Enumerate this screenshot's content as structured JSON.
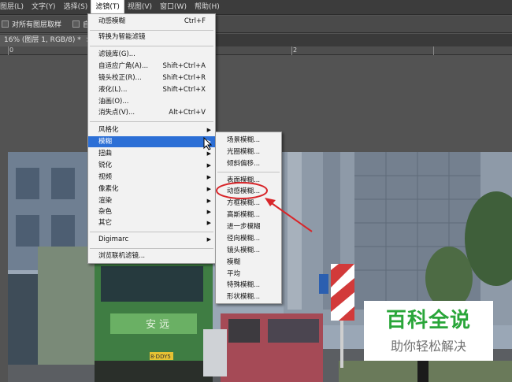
{
  "menubar": {
    "items": [
      {
        "label": "图层(L)"
      },
      {
        "label": "文字(Y)"
      },
      {
        "label": "选择(S)"
      },
      {
        "label": "滤镜(T)"
      },
      {
        "label": "视图(V)"
      },
      {
        "label": "窗口(W)"
      },
      {
        "label": "帮助(H)"
      }
    ]
  },
  "options_bar": {
    "sample_all_layers": "对所有图层取样",
    "auto_label": "自动"
  },
  "document_tab": {
    "label": "16% (图层 1, RGB/8) *",
    "close": "×"
  },
  "ruler": {
    "labels": [
      "0",
      "2"
    ]
  },
  "filter_menu": {
    "last_filter": {
      "label": "动感模糊",
      "shortcut": "Ctrl+F"
    },
    "convert_smart": "转换为智能滤镜",
    "gallery": "滤镜库(G)...",
    "adaptive_wide": {
      "label": "自适应广角(A)...",
      "shortcut": "Shift+Ctrl+A"
    },
    "lens_correction": {
      "label": "镜头校正(R)...",
      "shortcut": "Shift+Ctrl+R"
    },
    "liquify": {
      "label": "液化(L)...",
      "shortcut": "Shift+Ctrl+X"
    },
    "oil_paint": "油画(O)...",
    "vanishing_point": {
      "label": "消失点(V)...",
      "shortcut": "Alt+Ctrl+V"
    },
    "stylize": "风格化",
    "blur": "模糊",
    "distort": "扭曲",
    "sharpen": "锐化",
    "video": "视频",
    "pixelate": "像素化",
    "render": "渲染",
    "noise": "杂色",
    "other": "其它",
    "digimarc": "Digimarc",
    "browse_online": "浏览联机滤镜..."
  },
  "blur_submenu": {
    "items": [
      "场景模糊...",
      "光圈模糊...",
      "倾斜偏移...",
      "表面模糊...",
      "动感模糊...",
      "方框模糊...",
      "高斯模糊...",
      "进一步模糊",
      "径向模糊...",
      "镜头模糊...",
      "模糊",
      "平均",
      "特殊模糊...",
      "形状模糊..."
    ]
  },
  "photo": {
    "truck_sign": "安 远",
    "plate": "8·DDY5"
  },
  "watermark": {
    "title": "百科全说",
    "subtitle": "助你轻松解决",
    "color": "#2aa63a"
  },
  "colors": {
    "menu_highlight": "#2c6fd6",
    "annotation_red": "#d8262a"
  }
}
